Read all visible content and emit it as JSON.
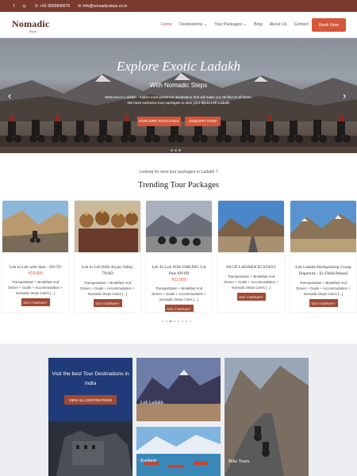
{
  "topbar": {
    "phone": "+91-9005840676",
    "email": "info@nomadicsteps.co.in",
    "social_icons": [
      "facebook-icon",
      "instagram-icon"
    ]
  },
  "nav": {
    "logo": "Nomadic",
    "logo_tag": "Steps",
    "items": [
      {
        "label": "Home"
      },
      {
        "label": "Destinations ⌄"
      },
      {
        "label": "Tour Packages ⌄"
      },
      {
        "label": "Blog"
      },
      {
        "label": "About Us"
      },
      {
        "label": "Contact"
      }
    ],
    "book": "Book Now"
  },
  "hero": {
    "title": "Explore Exotic Ladakh",
    "subtitle": "With Nomadic Steps",
    "description": "Welcome to Ladakh - India's most preferred destination that will make you thrilled at all times. We have exclusive tour packages to plan your trip to Leh Ladakh",
    "btn_explore": "EXPLORE PACKAGES",
    "btn_enquiry": "ENQUIRY NOW"
  },
  "section": {
    "eyebrow": "Looking for best tour packages to Ladakh ?",
    "title": "Trending Tour Packages"
  },
  "cards": [
    {
      "title": "Leh to Leh with Stok - 6N/7D",
      "price": "₹18,999",
      "desc": "Transportation + Breakfast And Dinner + Guide + Accommodation + Nomadic Steps Cares [...]",
      "btn": "SEE ITINERARY"
    },
    {
      "title": "Leh to Leh With Aryan Valley 7N/8D",
      "price": "",
      "desc": "Transportation + Breakfast And Dinner + Guide + Accommodation + Nomadic Steps Cares [...]",
      "btn": "SEE ITINERARY"
    },
    {
      "title": "Leh To Leh With UMLING LA Pass 8N/9D",
      "price": "₹23,999",
      "desc": "Transportation + Breakfast And Dinner + Guide + Accommodation + Nomadic Steps Cares [...]",
      "btn": "SEE ITINERARY"
    },
    {
      "title": "4N/5D LADAKH ECSTASY",
      "price": "",
      "desc": "Transportation + Breakfast And Dinner + Guide + Accommodation + Nomadic Steps Cares [...]",
      "btn": "SEE ITINERARY"
    },
    {
      "title": "Leh Ladakh Backpacking Group Departure - Ex Delhi/Manali",
      "price": "",
      "desc": "Transportation + Breakfast And Dinner + Guide + Accommodation + Nomadic Steps Cares [...]",
      "btn": "SEE ITINERARY"
    }
  ],
  "destinations": {
    "title": "Visit the best Tour Destinations in India",
    "btn": "VIEW ALL DESTINATIONS",
    "tiles": [
      {
        "caption": "Leh Ladakh"
      },
      {
        "caption": "Kashmir"
      },
      {
        "caption": "Bike Tours"
      }
    ]
  },
  "colors": {
    "accent": "#d4573a",
    "topbar": "#7a3b2e",
    "button_dark": "#a04a35"
  }
}
